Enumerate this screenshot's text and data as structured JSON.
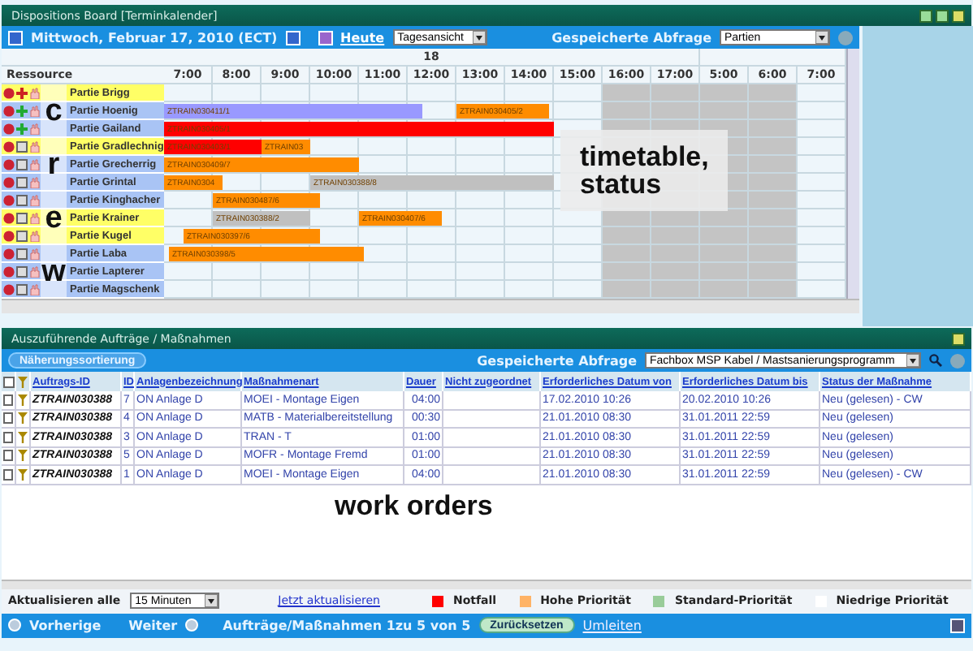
{
  "board": {
    "title": "Dispositions Board [Terminkalender]",
    "date": "Mittwoch, Februar 17, 2010 (ECT)",
    "today": "Heute",
    "view": "Tagesansicht",
    "saved_query_label": "Gespeicherte Abfrage",
    "saved_query": "Partien",
    "day": "18",
    "resource_header": "Ressource",
    "hours": [
      "7:00",
      "8:00",
      "9:00",
      "10:00",
      "11:00",
      "12:00",
      "13:00",
      "14:00",
      "15:00",
      "16:00",
      "17:00",
      "5:00",
      "6:00",
      "7:00"
    ],
    "rows": [
      {
        "name": "Partie Brigg",
        "color": "#ffff66",
        "kind": "red",
        "bars": []
      },
      {
        "name": "Partie Hoenig",
        "color": "#a9c4f5",
        "kind": "green",
        "bars": [
          {
            "label": "ZTRAIN030411/1",
            "color": "#9999ff"
          },
          {
            "label": "ZTRAIN030405/2",
            "color": "#ff8c00"
          }
        ]
      },
      {
        "name": "Partie Gailand",
        "color": "#a9c4f5",
        "kind": "green",
        "bars": [
          {
            "label": "ZTRAIN030405/1",
            "color": "#ff0000"
          }
        ]
      },
      {
        "name": "Partie Gradlechnig",
        "color": "#ffff66",
        "kind": "grey",
        "bars": [
          {
            "label": "ZTRAIN030403/1",
            "color": "#ff0000"
          },
          {
            "label": "ZTRAIN03",
            "color": "#ff8c00"
          }
        ]
      },
      {
        "name": "Partie Grecherrig",
        "color": "#a9c4f5",
        "kind": "grey",
        "bars": [
          {
            "label": "ZTRAIN030409/7",
            "color": "#ff8c00"
          }
        ]
      },
      {
        "name": "Partie Grintal",
        "color": "#a9c4f5",
        "kind": "grey",
        "bars": [
          {
            "label": "ZTRAIN0304",
            "color": "#ff8c00"
          },
          {
            "label": "ZTRAIN030388/8",
            "color": "#c0c0c0"
          }
        ]
      },
      {
        "name": "Partie Kinghacher",
        "color": "#a9c4f5",
        "kind": "grey",
        "bars": [
          {
            "label": "ZTRAIN030487/6",
            "color": "#ff8c00"
          }
        ]
      },
      {
        "name": "Partie Krainer",
        "color": "#ffff66",
        "kind": "grey",
        "bars": [
          {
            "label": "ZTRAIN030388/2",
            "color": "#c0c0c0"
          },
          {
            "label": "ZTRAIN030407/6",
            "color": "#ff8c00"
          }
        ]
      },
      {
        "name": "Partie Kugel",
        "color": "#ffff66",
        "kind": "grey",
        "bars": [
          {
            "label": "ZTRAIN030397/6",
            "color": "#ff8c00"
          }
        ]
      },
      {
        "name": "Partie Laba",
        "color": "#a9c4f5",
        "kind": "grey",
        "bars": [
          {
            "label": "ZTRAIN030398/5",
            "color": "#ff8c00"
          }
        ]
      },
      {
        "name": "Partie Lapterer",
        "color": "#a9c4f5",
        "kind": "grey",
        "bars": []
      },
      {
        "name": "Partie Magschenk",
        "color": "#a9c4f5",
        "kind": "grey",
        "bars": []
      }
    ]
  },
  "annotations": {
    "crew": [
      "c",
      "r",
      "e",
      "w"
    ],
    "timetable": "timetable,\nstatus",
    "orders": "work orders"
  },
  "orders": {
    "title": "Auszuführende Aufträge / Maßnahmen",
    "sort_button": "Näherungssortierung",
    "saved_query_label": "Gespeicherte Abfrage",
    "saved_query": "Fachbox MSP Kabel / Mastsanierungsprogramm",
    "select_all_checked": false,
    "columns": [
      "Auftrags-ID",
      "ID",
      "Anlagenbezeichnung",
      "Maßnahmenart",
      "Dauer",
      "Nicht zugeordnet",
      "Erforderliches Datum von",
      "Erforderliches Datum bis",
      "Status der Maßnahme"
    ],
    "rows": [
      {
        "checked": false,
        "cells": [
          "ZTRAIN030388",
          "7",
          "ON Anlage D",
          "MOEI - Montage Eigen",
          "04:00",
          "",
          "17.02.2010 10:26",
          "20.02.2010 10:26",
          "Neu (gelesen) - CW"
        ]
      },
      {
        "checked": false,
        "cells": [
          "ZTRAIN030388",
          "4",
          "ON Anlage D",
          "MATB - Materialbereitstellung",
          "00:30",
          "",
          "21.01.2010 08:30",
          "31.01.2011 22:59",
          "Neu (gelesen)"
        ]
      },
      {
        "checked": false,
        "cells": [
          "ZTRAIN030388",
          "3",
          "ON Anlage D",
          "TRAN - T",
          "01:00",
          "",
          "21.01.2010 08:30",
          "31.01.2011 22:59",
          "Neu (gelesen)"
        ]
      },
      {
        "checked": false,
        "cells": [
          "ZTRAIN030388",
          "5",
          "ON Anlage D",
          "MOFR - Montage Fremd",
          "01:00",
          "",
          "21.01.2010 08:30",
          "31.01.2011 22:59",
          "Neu (gelesen)"
        ]
      },
      {
        "checked": false,
        "cells": [
          "ZTRAIN030388",
          "1",
          "ON Anlage D",
          "MOEI - Montage Eigen",
          "04:00",
          "",
          "21.01.2010 08:30",
          "31.01.2011 22:59",
          "Neu (gelesen) - CW"
        ]
      }
    ],
    "refresh_label": "Aktualisieren alle",
    "refresh_interval": "15 Minuten",
    "refresh_now": "Jetzt aktualisieren",
    "legend": [
      {
        "label": "Notfall",
        "color": "#ff0000"
      },
      {
        "label": "Hohe Priorität",
        "color": "#ffb366"
      },
      {
        "label": "Standard-Priorität",
        "color": "#99cc99"
      },
      {
        "label": "Niedrige Priorität",
        "color": "#ffffff"
      }
    ],
    "previous": "Vorherige",
    "next": "Weiter",
    "paging": "Aufträge/Maßnahmen 1zu 5 von 5",
    "reset": "Zurücksetzen",
    "redirect": "Umleiten"
  }
}
